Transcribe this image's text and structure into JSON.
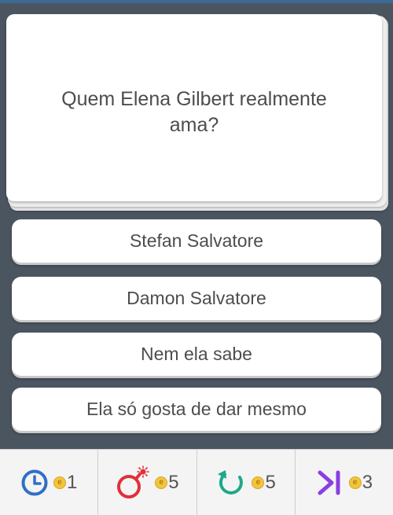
{
  "question": {
    "text": "Quem Elena Gilbert realmente ama?"
  },
  "answers": [
    {
      "label": "Stefan Salvatore"
    },
    {
      "label": "Damon Salvatore"
    },
    {
      "label": "Nem ela sabe"
    },
    {
      "label": "Ela só gosta de dar mesmo"
    }
  ],
  "powerups": [
    {
      "icon": "clock-icon",
      "color": "#2f6fc7",
      "coin_symbol": "e",
      "count": "1"
    },
    {
      "icon": "bomb-icon",
      "color": "#e0303a",
      "coin_symbol": "e",
      "count": "5"
    },
    {
      "icon": "refresh-icon",
      "color": "#1ea88a",
      "coin_symbol": "e",
      "count": "5"
    },
    {
      "icon": "skip-icon",
      "color": "#8a3fe0",
      "coin_symbol": "e",
      "count": "3"
    }
  ],
  "colors": {
    "background": "#4a5560",
    "card": "#ffffff",
    "text": "#4d4d4d",
    "coin": "#f2c53d"
  }
}
